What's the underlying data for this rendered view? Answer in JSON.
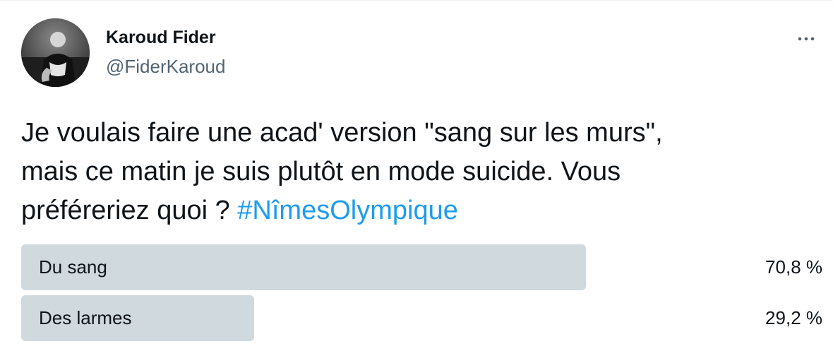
{
  "author": {
    "display_name": "Karoud Fider",
    "handle": "@FiderKaroud"
  },
  "more_icon": "more-horizontal-icon",
  "tweet": {
    "line1": "Je voulais faire une acad' version \"sang sur les murs\",",
    "line2": "mais ce matin je suis plutôt en mode suicide. Vous",
    "line3_text": "préféreriez quoi ? ",
    "hashtag": "#NîmesOlympique"
  },
  "poll": {
    "bar_color": "#cfd9de",
    "options": [
      {
        "label": "Du sang",
        "percent_text": "70,8 %",
        "fraction": 0.708
      },
      {
        "label": "Des larmes",
        "percent_text": "29,2 %",
        "fraction": 0.292
      }
    ]
  },
  "colors": {
    "hashtag": "#1d9bf0",
    "handle": "#536471",
    "text": "#0f1419"
  }
}
